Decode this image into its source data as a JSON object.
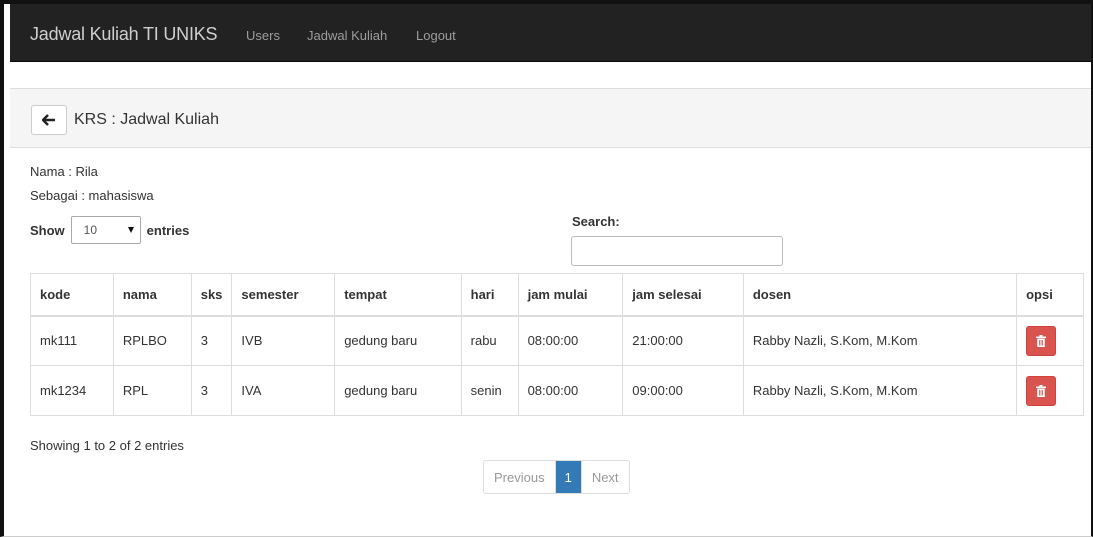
{
  "navbar": {
    "brand": "Jadwal Kuliah TI UNIKS",
    "links": [
      "Users",
      "Jadwal Kuliah",
      "Logout"
    ]
  },
  "panel": {
    "back_icon": "arrow-left-icon",
    "title": "KRS : Jadwal Kuliah"
  },
  "info": {
    "nama": "Nama   : Rila",
    "sebagai": "Sebagai : mahasiswa"
  },
  "length": {
    "show_label": "Show",
    "value": "10",
    "entries_label": "entries"
  },
  "search": {
    "label": "Search:",
    "value": ""
  },
  "table": {
    "headers": [
      "kode",
      "nama",
      "sks",
      "semester",
      "tempat",
      "hari",
      "jam mulai",
      "jam selesai",
      "dosen",
      "opsi"
    ],
    "rows": [
      [
        "mk111",
        "RPLBO",
        "3",
        "IVB",
        "gedung baru",
        "rabu",
        "08:00:00",
        "21:00:00",
        "Rabby Nazli, S.Kom, M.Kom"
      ],
      [
        "mk1234",
        "RPL",
        "3",
        "IVA",
        "gedung baru",
        "senin",
        "08:00:00",
        "09:00:00",
        "Rabby Nazli, S.Kom, M.Kom"
      ]
    ],
    "delete_icon": "trash-icon",
    "delete_color": "#d9534f"
  },
  "footer": {
    "status": "Showing 1 to 2 of 2 entries",
    "previous": "Previous",
    "page": "1",
    "next": "Next",
    "active_color": "#337ab7"
  }
}
